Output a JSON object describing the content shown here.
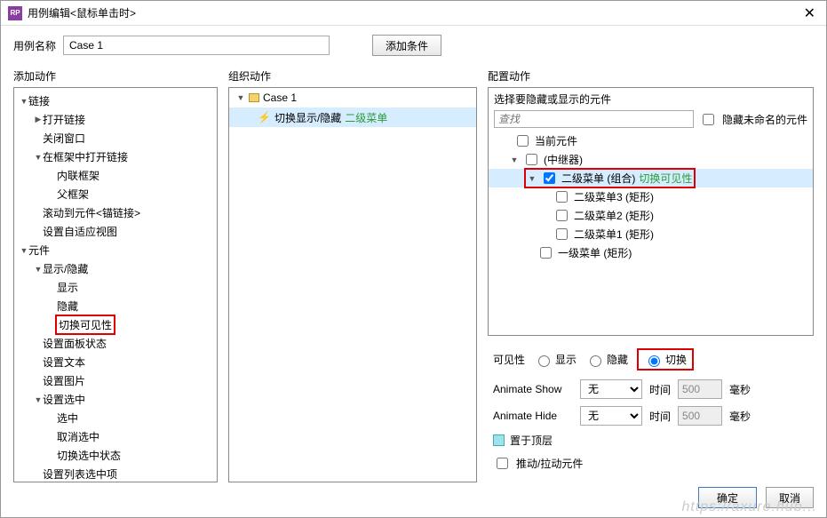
{
  "window": {
    "title": "用例编辑<鼠标单击时>"
  },
  "caseRow": {
    "nameLabel": "用例名称",
    "nameValue": "Case 1",
    "addConditionBtn": "添加条件"
  },
  "columns": {
    "addAction": "添加动作",
    "orgAction": "组织动作",
    "cfgAction": "配置动作"
  },
  "actionTree": {
    "link": "链接",
    "openLink": "打开链接",
    "closeWin": "关闭窗口",
    "openInFrame": "在框架中打开链接",
    "inlineFrame": "内联框架",
    "parentFrame": "父框架",
    "scrollTo": "滚动到元件<锚链接>",
    "setAdaptive": "设置自适应视图",
    "component": "元件",
    "showHide": "显示/隐藏",
    "show": "显示",
    "hide": "隐藏",
    "toggleVis": "切换可见性",
    "panelState": "设置面板状态",
    "setText": "设置文本",
    "setImage": "设置图片",
    "setSelected": "设置选中",
    "select": "选中",
    "deselect": "取消选中",
    "toggleSel": "切换选中状态",
    "setListSel": "设置列表选中项"
  },
  "orgTree": {
    "case1": "Case 1",
    "toggleShowHide": "切换显示/隐藏",
    "secondMenu": "二级菜单"
  },
  "config": {
    "selectPrompt": "选择要隐藏或显示的元件",
    "searchPlaceholder": "查找",
    "hideUnnamed": "隐藏未命名的元件",
    "currentComp": "当前元件",
    "repeater": "(中继器)",
    "secondMenuGroup": "二级菜单 (组合)",
    "toggleVisGreen": "切换可见性",
    "sub3": "二级菜单3 (矩形)",
    "sub2": "二级菜单2 (矩形)",
    "sub1": "二级菜单1 (矩形)",
    "firstMenu": "一级菜单 (矩形)"
  },
  "visibility": {
    "label": "可见性",
    "show": "显示",
    "hide": "隐藏",
    "toggle": "切换"
  },
  "animate": {
    "showLabel": "Animate Show",
    "hideLabel": "Animate Hide",
    "none": "无",
    "timeLabel": "时间",
    "timeVal": "500",
    "ms": "毫秒"
  },
  "options": {
    "bringFront": "置于顶层",
    "pushPull": "推动/拉动元件"
  },
  "footer": {
    "ok": "确定",
    "cancel": "取消"
  },
  "watermark": "https://axure.hub..."
}
